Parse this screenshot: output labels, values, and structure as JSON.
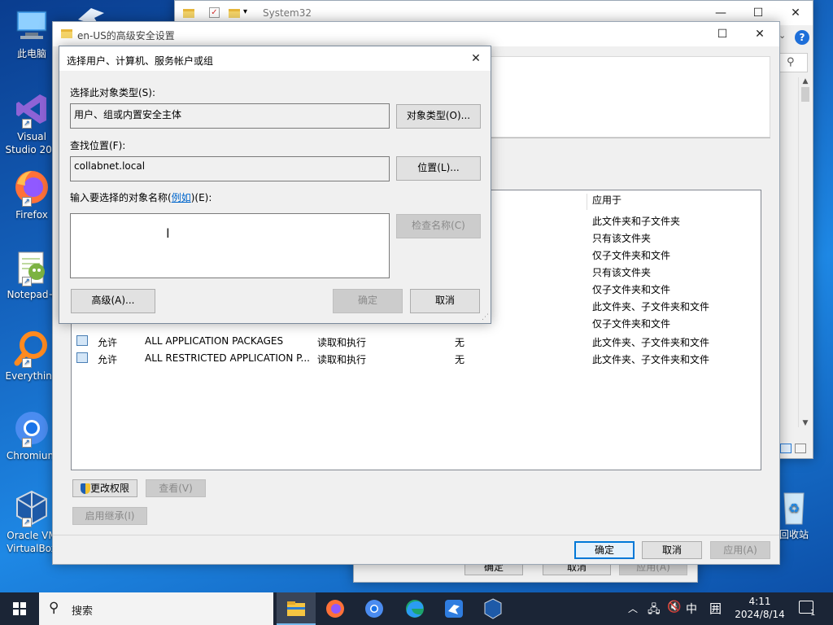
{
  "desktop": {
    "icons": [
      {
        "label": "此电脑",
        "icon": "computer-icon"
      },
      {
        "label": "Visual Studio 201",
        "icon": "visual-studio-icon"
      },
      {
        "label": "Firefox",
        "icon": "firefox-icon"
      },
      {
        "label": "Notepad+",
        "icon": "notepad-plus-icon"
      },
      {
        "label": "Everything",
        "icon": "everything-search-icon"
      },
      {
        "label": "Chromium",
        "icon": "chromium-icon"
      },
      {
        "label": "Oracle VM VirtualBox",
        "icon": "virtualbox-icon"
      }
    ],
    "recycle_label": "回收站"
  },
  "explorer": {
    "title": "System32"
  },
  "security_window": {
    "title": "en-US的高级安全设置",
    "columns": {
      "applies_to": "应用于"
    },
    "applies_rows": [
      "此文件夹和子文件夹",
      "只有该文件夹",
      "仅子文件夹和文件",
      "只有该文件夹",
      "仅子文件夹和文件",
      "此文件夹、子文件夹和文件",
      "仅子文件夹和文件"
    ],
    "entries": [
      {
        "type": "允许",
        "principal": "ALL APPLICATION PACKAGES",
        "access": "读取和执行",
        "inherited": "无",
        "applies": "此文件夹、子文件夹和文件"
      },
      {
        "type": "允许",
        "principal": "ALL RESTRICTED APPLICATION P...",
        "access": "读取和执行",
        "inherited": "无",
        "applies": "此文件夹、子文件夹和文件"
      }
    ],
    "change_perm_label": "更改权限",
    "view_label": "查看(V)",
    "disable_inherit_label": "启用继承(I)",
    "ok_label": "确定",
    "cancel_label": "取消",
    "apply_label": "应用(A)"
  },
  "back_dialog": {
    "ok_label": "确定",
    "cancel_label": "取消",
    "apply_label": "应用(A)"
  },
  "select_dialog": {
    "title": "选择用户、计算机、服务帐户或组",
    "object_type_label": "选择此对象类型(S):",
    "object_type_value": "用户、组或内置安全主体",
    "object_types_button": "对象类型(O)...",
    "location_label": "查找位置(F):",
    "location_value": "collabnet.local",
    "location_button": "位置(L)...",
    "enter_names_label_pre": "输入要选择的对象名称(",
    "examples_link": "例如",
    "enter_names_label_post": ")(E):",
    "names_value": "",
    "check_names_button": "检查名称(C)",
    "advanced_button": "高级(A)...",
    "ok_button": "确定",
    "cancel_button": "取消"
  },
  "taskbar": {
    "search_placeholder": "搜索",
    "ime_label": "中",
    "clock_time": "4:11",
    "clock_date": "2024/8/14",
    "notification_count": "1"
  },
  "colors": {
    "accent": "#0078d7",
    "link": "#0066cc",
    "taskbar": "#1b2536"
  }
}
